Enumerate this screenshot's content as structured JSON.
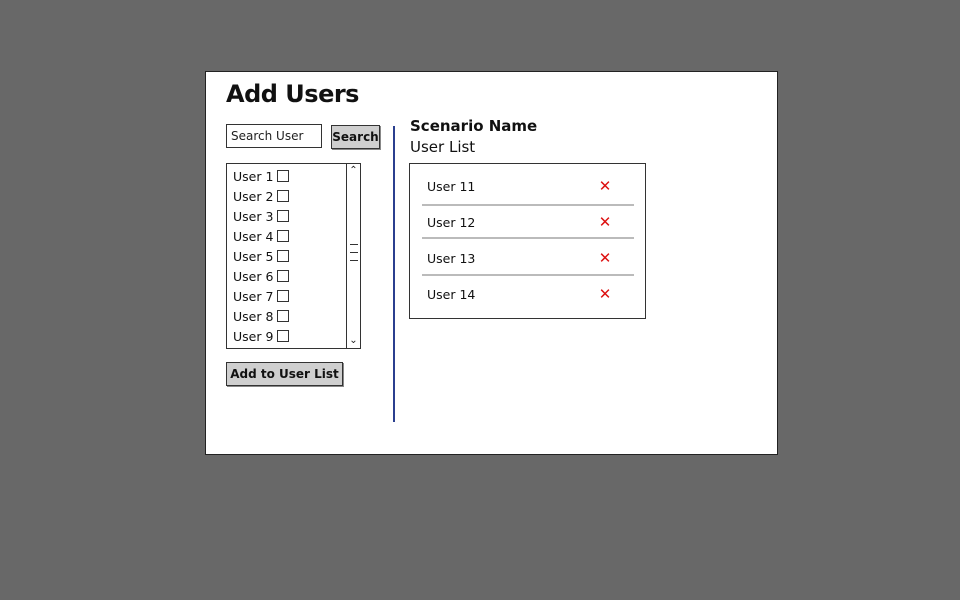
{
  "dialog": {
    "title": "Add Users"
  },
  "search": {
    "placeholder": "Search User",
    "button_label": "Search"
  },
  "available_users": [
    {
      "label": "User 1",
      "checked": false
    },
    {
      "label": "User 2",
      "checked": false
    },
    {
      "label": "User 3",
      "checked": false
    },
    {
      "label": "User 4",
      "checked": false
    },
    {
      "label": "User 5",
      "checked": false
    },
    {
      "label": "User 6",
      "checked": false
    },
    {
      "label": "User 7",
      "checked": false
    },
    {
      "label": "User 8",
      "checked": false
    },
    {
      "label": "User 9",
      "checked": false
    }
  ],
  "add_button_label": "Add to User List",
  "scenario": {
    "name": "Scenario Name",
    "list_heading": "User List"
  },
  "user_list": [
    {
      "name": "User 11",
      "remove_icon": "close-icon"
    },
    {
      "name": "User 12",
      "remove_icon": "close-icon"
    },
    {
      "name": "User 13",
      "remove_icon": "close-icon"
    },
    {
      "name": "User 14",
      "remove_icon": "close-icon"
    }
  ],
  "colors": {
    "background": "#686868",
    "divider": "#2b3f8f",
    "remove": "#dd1111",
    "button": "#cfcfcf"
  }
}
